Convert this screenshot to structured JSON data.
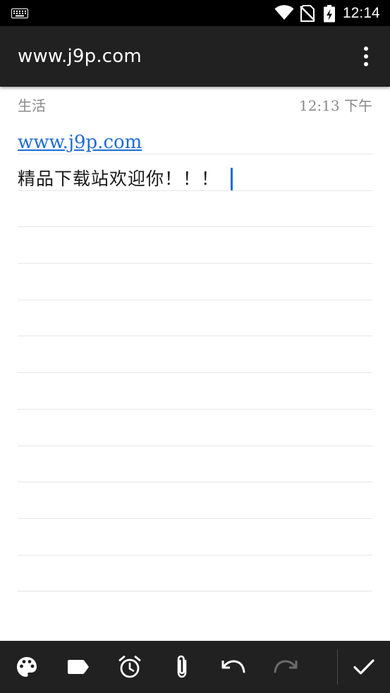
{
  "status_bar": {
    "time": "12:14",
    "icons": [
      "keyboard-icon",
      "wifi-icon",
      "no-sim-icon",
      "battery-charging-icon"
    ]
  },
  "app_bar": {
    "title": "www.j9p.com",
    "menu_icon": "more-vert-icon"
  },
  "note": {
    "label": "生活",
    "timestamp": "12:13 下午",
    "link": "www.j9p.com",
    "body": "精品下载站欢迎你！！！"
  },
  "toolbar": {
    "items": [
      "palette-icon",
      "label-icon",
      "alarm-icon",
      "attach-icon",
      "undo-icon",
      "redo-icon",
      "done-icon"
    ],
    "redo_enabled": false
  },
  "colors": {
    "status_bar": "#000000",
    "app_bar": "#212121",
    "toolbar": "#212121",
    "link": "#1e6bd6",
    "meta_text": "#8a8a8a",
    "rule_line": "#e6e6e6"
  }
}
